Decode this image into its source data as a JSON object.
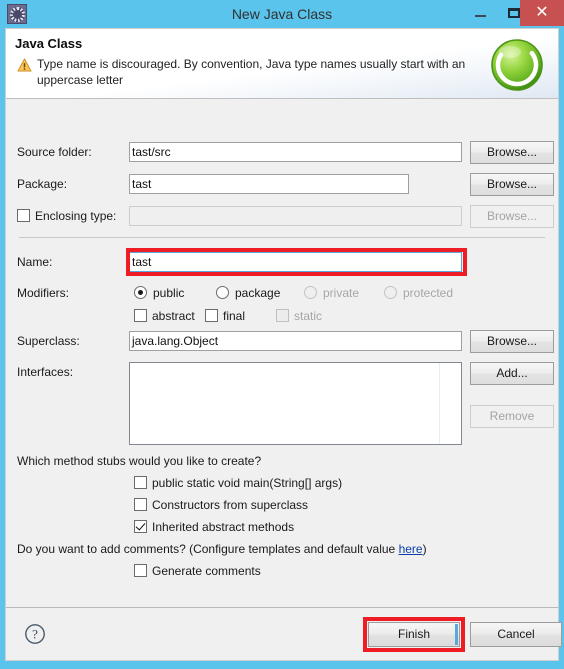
{
  "window": {
    "title": "New Java Class",
    "icon": "gear-icon",
    "controls": {
      "minimize": "minimize-icon",
      "maximize": "maximize-icon",
      "close": "close-icon"
    },
    "colors": {
      "titlebar": "#5bc4ec",
      "close_button": "#c75050",
      "annotation": "#ee1c25",
      "link": "#0b3fa8"
    }
  },
  "header": {
    "title": "Java Class",
    "message": "Type name is discouraged. By convention, Java type names usually start with an uppercase letter",
    "status_icon": "warning-icon",
    "logo_icon": "eclipse-c-logo-icon"
  },
  "form": {
    "source_folder": {
      "label": "Source folder:",
      "value": "tast/src",
      "button": "Browse...",
      "disabled": false
    },
    "package": {
      "label": "Package:",
      "value": "tast",
      "button": "Browse...",
      "disabled": false
    },
    "enclosing_type": {
      "label": "Enclosing type:",
      "value": "",
      "button": "Browse...",
      "checked": false,
      "disabled": true
    },
    "name": {
      "label": "Name:",
      "value": "tast",
      "focused": true,
      "highlighted": true
    },
    "modifiers": {
      "label": "Modifiers:",
      "access": [
        {
          "label": "public",
          "checked": true,
          "disabled": false
        },
        {
          "label": "package",
          "checked": false,
          "disabled": false
        },
        {
          "label": "private",
          "checked": false,
          "disabled": true
        },
        {
          "label": "protected",
          "checked": false,
          "disabled": true
        }
      ],
      "flags": [
        {
          "label": "abstract",
          "checked": false,
          "disabled": false
        },
        {
          "label": "final",
          "checked": false,
          "disabled": false
        },
        {
          "label": "static",
          "checked": false,
          "disabled": true
        }
      ]
    },
    "superclass": {
      "label": "Superclass:",
      "value": "java.lang.Object",
      "button": "Browse..."
    },
    "interfaces": {
      "label": "Interfaces:",
      "items": [],
      "add_button": "Add...",
      "remove_button": "Remove",
      "remove_disabled": true
    }
  },
  "stubs": {
    "question": "Which method stubs would you like to create?",
    "options": [
      {
        "label": "public static void main(String[] args)",
        "checked": false
      },
      {
        "label": "Constructors from superclass",
        "checked": false
      },
      {
        "label": "Inherited abstract methods",
        "checked": true
      }
    ]
  },
  "comments": {
    "question_prefix": "Do you want to add comments? (Configure templates and default value ",
    "link": "here",
    "question_suffix": ")",
    "option": {
      "label": "Generate comments",
      "checked": false
    }
  },
  "buttonbar": {
    "help_icon": "help-question-icon",
    "finish": "Finish",
    "cancel": "Cancel",
    "finish_highlighted": true
  }
}
